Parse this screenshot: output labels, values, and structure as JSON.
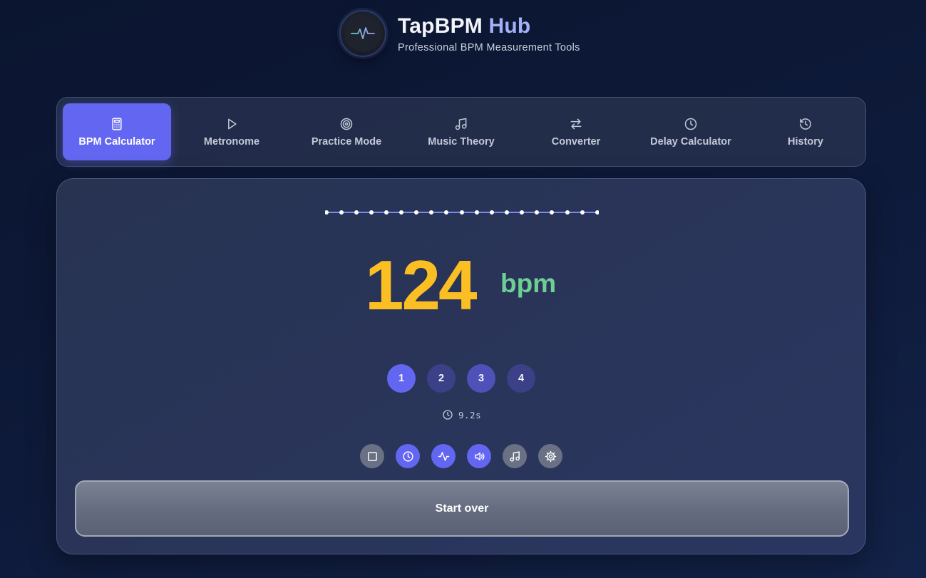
{
  "app": {
    "title_main": "TapBPM",
    "title_accent": "Hub",
    "subtitle": "Professional BPM Measurement Tools",
    "logo_icon": "pulse-wave-icon"
  },
  "tabs": [
    {
      "label": "BPM Calculator",
      "icon": "calculator-icon",
      "active": true
    },
    {
      "label": "Metronome",
      "icon": "play-icon",
      "active": false
    },
    {
      "label": "Practice Mode",
      "icon": "target-icon",
      "active": false
    },
    {
      "label": "Music Theory",
      "icon": "music-note-icon",
      "active": false
    },
    {
      "label": "Converter",
      "icon": "swap-arrows-icon",
      "active": false
    },
    {
      "label": "Delay Calculator",
      "icon": "clock-icon",
      "active": false
    },
    {
      "label": "History",
      "icon": "history-icon",
      "active": false
    }
  ],
  "calculator": {
    "bpm": "124",
    "unit": "bpm",
    "beats": [
      {
        "label": "1",
        "state": "active"
      },
      {
        "label": "2",
        "state": "dim"
      },
      {
        "label": "3",
        "state": "mid"
      },
      {
        "label": "4",
        "state": "dim"
      }
    ],
    "elapsed": "9.2s",
    "controls": [
      {
        "icon": "square-stop-icon",
        "on": false
      },
      {
        "icon": "clock-icon",
        "on": true
      },
      {
        "icon": "activity-icon",
        "on": true
      },
      {
        "icon": "volume-icon",
        "on": true
      },
      {
        "icon": "music-note-icon",
        "on": false
      },
      {
        "icon": "settings-gear-icon",
        "on": false
      }
    ],
    "start_over_label": "Start over"
  },
  "colors": {
    "accent": "#6366f1",
    "bpm": "#fbbf24",
    "unit": "#6ecf94",
    "background": "#0e1a3a"
  }
}
